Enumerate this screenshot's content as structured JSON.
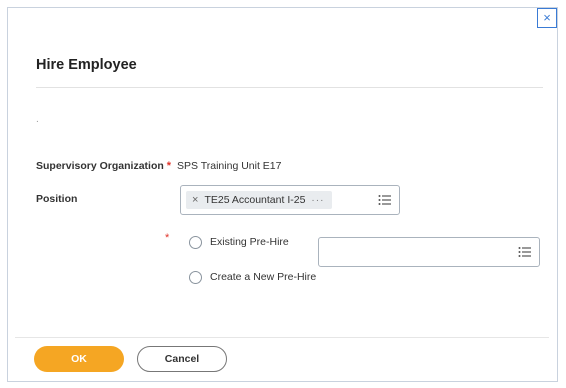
{
  "dialog": {
    "title": "Hire Employee",
    "close_label": "×",
    "dot": "."
  },
  "form": {
    "supervisory_org": {
      "label": "Supervisory Organization",
      "required_mark": "*",
      "value": "SPS Training Unit E17"
    },
    "position": {
      "label": "Position",
      "chip_remove": "×",
      "chip_value": "TE25 Accountant I-25",
      "chip_more": "···"
    },
    "pre_hire": {
      "required_mark": "*",
      "option_existing": "Existing Pre-Hire",
      "option_create": "Create a New Pre-Hire",
      "existing_value": ""
    }
  },
  "footer": {
    "ok_label": "OK",
    "cancel_label": "Cancel"
  },
  "colors": {
    "accent": "#f5a623",
    "required": "#e0342a",
    "close_border": "#3a7bd5"
  }
}
